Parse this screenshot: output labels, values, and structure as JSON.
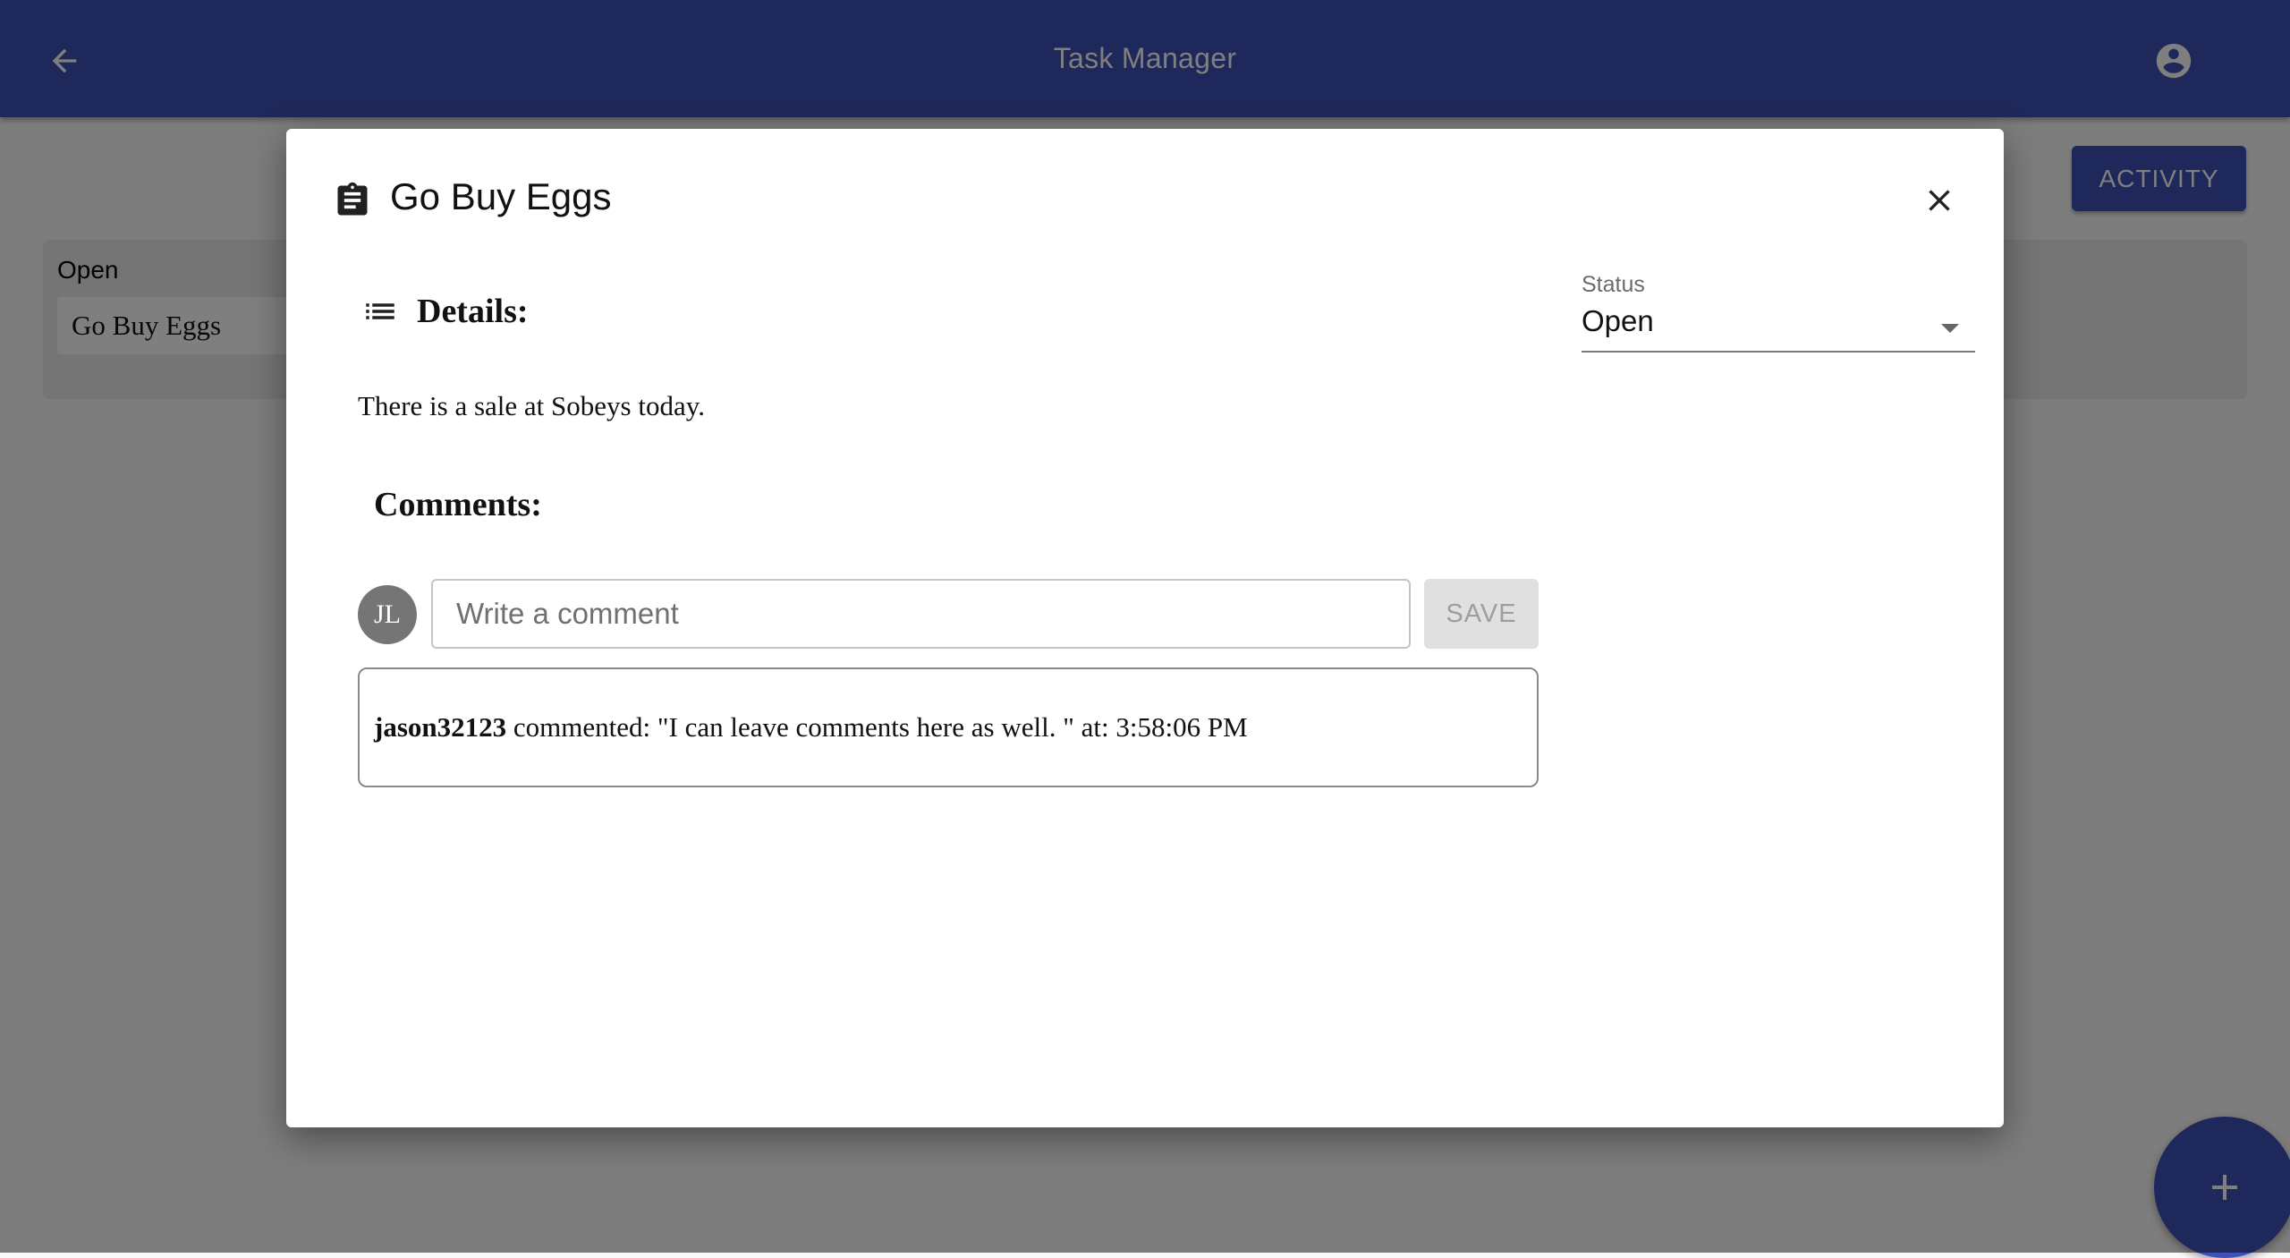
{
  "app": {
    "title": "Task Manager",
    "activity_label": "ACTIVITY",
    "accent_color": "#3f51b5",
    "icons": {
      "back": "arrow-back-icon",
      "account": "account-circle-icon",
      "add": "add-icon"
    }
  },
  "board": {
    "columns": [
      {
        "title": "Open",
        "cards": [
          "Go Buy Eggs"
        ]
      }
    ]
  },
  "dialog": {
    "title": "Go Buy Eggs",
    "icons": {
      "title": "clipboard-icon",
      "details": "list-icon",
      "close": "close-icon"
    },
    "details_label": "Details:",
    "details_text": "There is a sale at Sobeys today.",
    "comments_label": "Comments:",
    "avatar_initials": "JL",
    "comment_placeholder": "Write a comment",
    "comment_value": "",
    "save_label": "SAVE",
    "comments": [
      {
        "author": "jason32123",
        "text": " commented: \"I can leave comments here as well. \" at: 3:58:06 PM"
      }
    ],
    "status": {
      "label": "Status",
      "value": "Open"
    }
  }
}
